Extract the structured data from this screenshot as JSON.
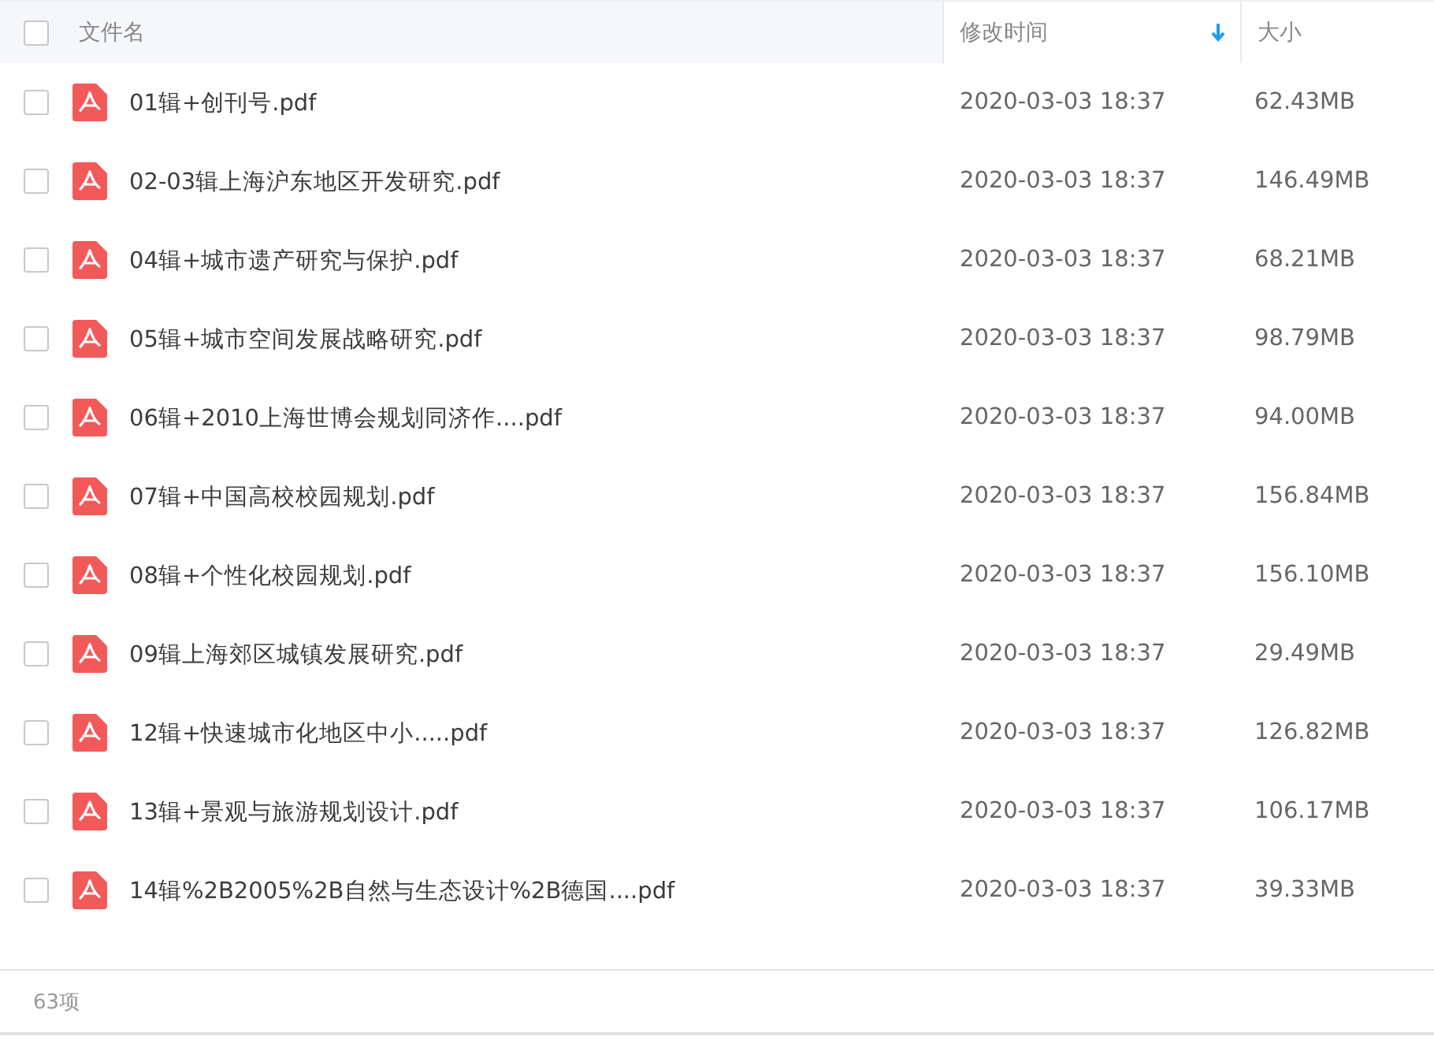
{
  "table": {
    "select_all": {
      "checked": false
    },
    "columns": [
      {
        "label": "文件名",
        "sorted": false
      },
      {
        "label": "修改时间",
        "sorted": true
      },
      {
        "label": "大小",
        "sorted": false
      }
    ],
    "rows": [
      {
        "checked": false,
        "name": "01辑+创刊号.pdf",
        "modified": "2020-03-03 18:37",
        "size": "62.43MB"
      },
      {
        "checked": false,
        "name": "02-03辑上海沪东地区开发研究.pdf",
        "modified": "2020-03-03 18:37",
        "size": "146.49MB"
      },
      {
        "checked": false,
        "name": "04辑+城市遗产研究与保护.pdf",
        "modified": "2020-03-03 18:37",
        "size": "68.21MB"
      },
      {
        "checked": false,
        "name": "05辑+城市空间发展战略研究.pdf",
        "modified": "2020-03-03 18:37",
        "size": "98.79MB"
      },
      {
        "checked": false,
        "name": "06辑+2010上海世博会规划同济作....pdf",
        "modified": "2020-03-03 18:37",
        "size": "94.00MB"
      },
      {
        "checked": false,
        "name": "07辑+中国高校校园规划.pdf",
        "modified": "2020-03-03 18:37",
        "size": "156.84MB"
      },
      {
        "checked": false,
        "name": "08辑+个性化校园规划.pdf",
        "modified": "2020-03-03 18:37",
        "size": "156.10MB"
      },
      {
        "checked": false,
        "name": "09辑上海郊区城镇发展研究.pdf",
        "modified": "2020-03-03 18:37",
        "size": "29.49MB"
      },
      {
        "checked": false,
        "name": "12辑+快速城市化地区中小.....pdf",
        "modified": "2020-03-03 18:37",
        "size": "126.82MB"
      },
      {
        "checked": false,
        "name": "13辑+景观与旅游规划设计.pdf",
        "modified": "2020-03-03 18:37",
        "size": "106.17MB"
      },
      {
        "checked": false,
        "name": "14辑%2B2005%2B自然与生态设计%2B德国....pdf",
        "modified": "2020-03-03 18:37",
        "size": "39.33MB"
      }
    ]
  },
  "status_bar": {
    "count": "63项"
  }
}
